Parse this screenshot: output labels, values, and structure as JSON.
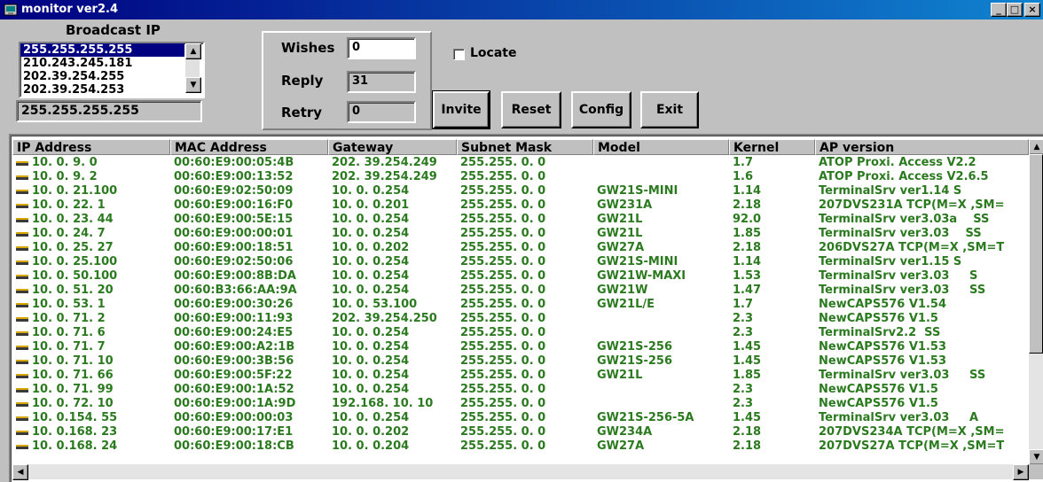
{
  "window": {
    "title": "monitor ver2.4",
    "min_glyph": "_",
    "max_glyph": "□",
    "close_glyph": "×",
    "icon": "app-icon"
  },
  "broadcast": {
    "label": "Broadcast IP",
    "items": [
      "255.255.255.255",
      "210.243.245.181",
      "202.39.254.255",
      "202.39.254.253"
    ],
    "selected_index": 0,
    "current_value": "255.255.255.255"
  },
  "stats": {
    "wishes_label": "Wishes",
    "wishes_value": "0",
    "reply_label": "Reply",
    "reply_value": "31",
    "retry_label": "Retry",
    "retry_value": "0"
  },
  "locate": {
    "label": "Locate",
    "checked": false
  },
  "buttons": {
    "invite": "Invite",
    "reset": "Reset",
    "config": "Config",
    "exit": "Exit"
  },
  "table": {
    "columns": [
      "IP Address",
      "MAC Address",
      "Gateway",
      "Subnet Mask",
      "Model",
      "Kernel",
      "AP version"
    ],
    "rows": [
      [
        "10. 0. 9. 0",
        "00:60:E9:00:05:4B",
        "202. 39.254.249",
        "255.255. 0. 0",
        "",
        "1.7",
        "ATOP Proxi. Access V2.2"
      ],
      [
        "10. 0. 9. 2",
        "00:60:E9:00:13:52",
        "202. 39.254.249",
        "255.255. 0. 0",
        "",
        "1.6",
        "ATOP Proxi. Access V2.6.5"
      ],
      [
        "10. 0. 21.100",
        "00:60:E9:02:50:09",
        "10. 0. 0.254",
        "255.255. 0. 0",
        "GW21S-MINI",
        "1.14",
        "TerminalSrv ver1.14 S"
      ],
      [
        "10. 0. 22. 1",
        "00:60:E9:00:16:F0",
        "10. 0. 0.201",
        "255.255. 0. 0",
        "GW231A",
        "2.18",
        "207DVS231A TCP(M=X ,SM="
      ],
      [
        "10. 0. 23. 44",
        "00:60:E9:00:5E:15",
        "10. 0. 0.254",
        "255.255. 0. 0",
        "GW21L",
        "92.0",
        "TerminalSrv ver3.03a    SS"
      ],
      [
        "10. 0. 24. 7",
        "00:60:E9:00:00:01",
        "10. 0. 0.254",
        "255.255. 0. 0",
        "GW21L",
        "1.85",
        "TerminalSrv ver3.03    SS"
      ],
      [
        "10. 0. 25. 27",
        "00:60:E9:00:18:51",
        "10. 0. 0.202",
        "255.255. 0. 0",
        "GW27A",
        "2.18",
        "206DVS27A TCP(M=X ,SM=T"
      ],
      [
        "10. 0. 25.100",
        "00:60:E9:02:50:06",
        "10. 0. 0.254",
        "255.255. 0. 0",
        "GW21S-MINI",
        "1.14",
        "TerminalSrv ver1.15 S"
      ],
      [
        "10. 0. 50.100",
        "00:60:E9:00:8B:DA",
        "10. 0. 0.254",
        "255.255. 0. 0",
        "GW21W-MAXI",
        "1.53",
        "TerminalSrv ver3.03     S"
      ],
      [
        "10. 0. 51. 20",
        "00:60:B3:66:AA:9A",
        "10. 0. 0.254",
        "255.255. 0. 0",
        "GW21W",
        "1.47",
        "TerminalSrv ver3.03     SS"
      ],
      [
        "10. 0. 53. 1",
        "00:60:E9:00:30:26",
        "10. 0. 53.100",
        "255.255. 0. 0",
        "GW21L/E",
        "1.7",
        "NewCAPS576 V1.54"
      ],
      [
        "10. 0. 71. 2",
        "00:60:E9:00:11:93",
        "202. 39.254.250",
        "255.255. 0. 0",
        "",
        "2.3",
        "NewCAPS576 V1.5"
      ],
      [
        "10. 0. 71. 6",
        "00:60:E9:00:24:E5",
        "10. 0. 0.254",
        "255.255. 0. 0",
        "",
        "2.3",
        "TerminalSrv2.2  SS"
      ],
      [
        "10. 0. 71. 7",
        "00:60:E9:00:A2:1B",
        "10. 0. 0.254",
        "255.255. 0. 0",
        "GW21S-256",
        "1.45",
        "NewCAPS576 V1.53"
      ],
      [
        "10. 0. 71. 10",
        "00:60:E9:00:3B:56",
        "10. 0. 0.254",
        "255.255. 0. 0",
        "GW21S-256",
        "1.45",
        "NewCAPS576 V1.53"
      ],
      [
        "10. 0. 71. 66",
        "00:60:E9:00:5F:22",
        "10. 0. 0.254",
        "255.255. 0. 0",
        "GW21L",
        "1.85",
        "TerminalSrv ver3.03     SS"
      ],
      [
        "10. 0. 71. 99",
        "00:60:E9:00:1A:52",
        "10. 0. 0.254",
        "255.255. 0. 0",
        "",
        "2.3",
        "NewCAPS576 V1.5"
      ],
      [
        "10. 0. 72. 10",
        "00:60:E9:00:1A:9D",
        "192.168. 10. 10",
        "255.255. 0. 0",
        "",
        "2.3",
        "NewCAPS576 V1.5"
      ],
      [
        "10. 0.154. 55",
        "00:60:E9:00:00:03",
        "10. 0. 0.254",
        "255.255. 0. 0",
        "GW21S-256-5A",
        "1.45",
        "TerminalSrv ver3.03     A"
      ],
      [
        "10. 0.168. 23",
        "00:60:E9:00:17:E1",
        "10. 0. 0.202",
        "255.255. 0. 0",
        "GW234A",
        "2.18",
        "207DVS234A TCP(M=X ,SM="
      ],
      [
        "10. 0.168. 24",
        "00:60:E9:00:18:CB",
        "10. 0. 0.204",
        "255.255. 0. 0",
        "GW27A",
        "2.18",
        "207DVS27A TCP(M=X ,SM=T"
      ]
    ]
  },
  "colors": {
    "row_text": "#2c7a20",
    "title_bar": "#000080",
    "selection": "#000080"
  }
}
